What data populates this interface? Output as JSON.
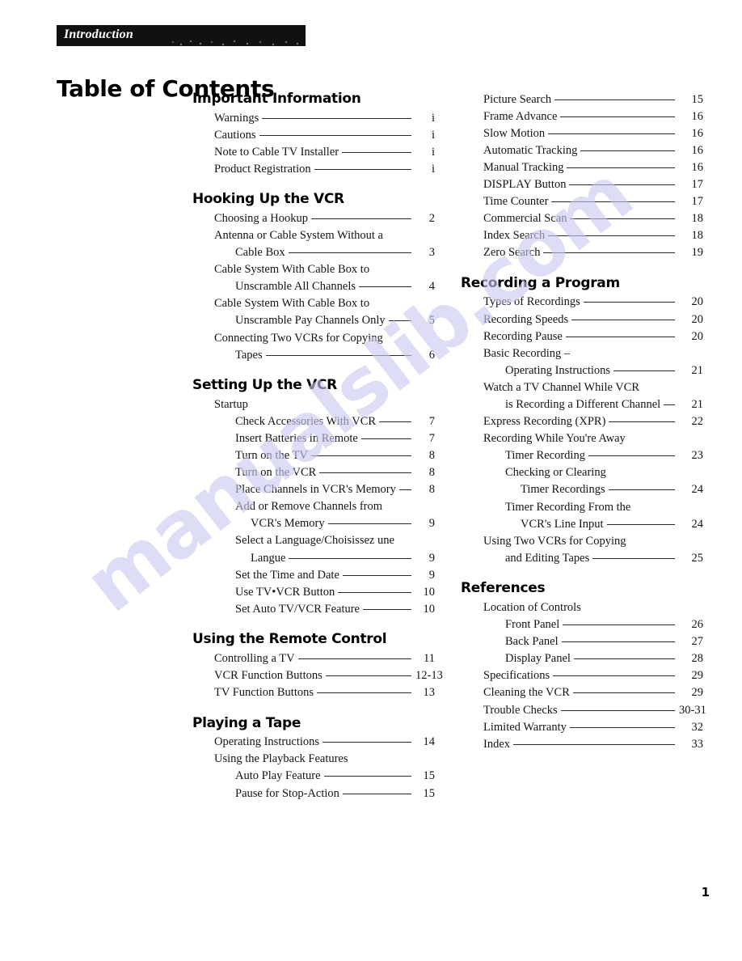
{
  "header": {
    "band_label": "Introduction",
    "page_title": "Table of Contents",
    "folio": "1"
  },
  "watermark": {
    "text": "manualslib.com"
  },
  "left_column": [
    {
      "heading": "Important Information",
      "entries": [
        {
          "title": "Warnings",
          "page": "i",
          "level": 1,
          "leader": true
        },
        {
          "title": "Cautions",
          "page": "i",
          "level": 1,
          "leader": true
        },
        {
          "title": "Note to Cable TV Installer",
          "page": "i",
          "level": 1,
          "leader": true
        },
        {
          "title": "Product Registration",
          "page": "i",
          "level": 1,
          "leader": true
        }
      ]
    },
    {
      "heading": "Hooking Up the VCR",
      "entries": [
        {
          "title": "Choosing a Hookup",
          "page": "2",
          "level": 1,
          "leader": true
        },
        {
          "title": "Antenna or Cable System Without a",
          "page": "",
          "level": 1,
          "leader": false
        },
        {
          "title": "Cable Box",
          "page": "3",
          "level": 2,
          "leader": true
        },
        {
          "title": "Cable System With Cable Box to",
          "page": "",
          "level": 1,
          "leader": false
        },
        {
          "title": "Unscramble All Channels",
          "page": "4",
          "level": 2,
          "leader": true
        },
        {
          "title": "Cable System With Cable Box to",
          "page": "",
          "level": 1,
          "leader": false
        },
        {
          "title": "Unscramble Pay Channels Only",
          "page": "5",
          "level": 2,
          "leader": true
        },
        {
          "title": "Connecting Two VCRs for Copying",
          "page": "",
          "level": 1,
          "leader": false
        },
        {
          "title": "Tapes",
          "page": "6",
          "level": 2,
          "leader": true
        }
      ]
    },
    {
      "heading": "Setting Up the VCR",
      "entries": [
        {
          "title": "Startup",
          "page": "",
          "level": 1,
          "leader": false
        },
        {
          "title": "Check Accessories With VCR",
          "page": "7",
          "level": 2,
          "leader": true
        },
        {
          "title": "Insert Batteries in Remote",
          "page": "7",
          "level": 2,
          "leader": true
        },
        {
          "title": "Turn on the TV",
          "page": "8",
          "level": 2,
          "leader": true
        },
        {
          "title": "Turn on the VCR",
          "page": "8",
          "level": 2,
          "leader": true
        },
        {
          "title": "Place Channels in VCR's Memory",
          "page": "8",
          "level": 2,
          "leader": true
        },
        {
          "title": "Add or Remove Channels from",
          "page": "",
          "level": 2,
          "leader": false
        },
        {
          "title": "VCR's Memory",
          "page": "9",
          "level": 3,
          "leader": true
        },
        {
          "title": "Select a Language/Choisissez une",
          "page": "",
          "level": 2,
          "leader": false
        },
        {
          "title": "Langue",
          "page": "9",
          "level": 3,
          "leader": true
        },
        {
          "title": "Set the Time and Date",
          "page": "9",
          "level": 2,
          "leader": true
        },
        {
          "title": "Use TV•VCR Button",
          "page": "10",
          "level": 2,
          "leader": true
        },
        {
          "title": "Set Auto TV/VCR Feature",
          "page": "10",
          "level": 2,
          "leader": true
        }
      ]
    },
    {
      "heading": "Using the Remote Control",
      "entries": [
        {
          "title": "Controlling a TV",
          "page": "11",
          "level": 1,
          "leader": true
        },
        {
          "title": "VCR Function Buttons",
          "page": "12-13",
          "level": 1,
          "leader": true
        },
        {
          "title": "TV Function Buttons",
          "page": "13",
          "level": 1,
          "leader": true
        }
      ]
    },
    {
      "heading": "Playing a Tape",
      "entries": [
        {
          "title": "Operating Instructions",
          "page": "14",
          "level": 1,
          "leader": true
        },
        {
          "title": "Using the Playback Features",
          "page": "",
          "level": 1,
          "leader": false
        },
        {
          "title": "Auto Play Feature",
          "page": "15",
          "level": 2,
          "leader": true
        },
        {
          "title": "Pause for Stop-Action",
          "page": "15",
          "level": 2,
          "leader": true
        }
      ]
    }
  ],
  "right_column": [
    {
      "heading": "",
      "entries": [
        {
          "title": "Picture Search",
          "page": "15",
          "level": 1,
          "leader": true
        },
        {
          "title": "Frame Advance",
          "page": "16",
          "level": 1,
          "leader": true
        },
        {
          "title": "Slow Motion",
          "page": "16",
          "level": 1,
          "leader": true
        },
        {
          "title": "Automatic Tracking",
          "page": "16",
          "level": 1,
          "leader": true
        },
        {
          "title": "Manual Tracking",
          "page": "16",
          "level": 1,
          "leader": true
        },
        {
          "title": "DISPLAY Button",
          "page": "17",
          "level": 1,
          "leader": true
        },
        {
          "title": "Time Counter",
          "page": "17",
          "level": 1,
          "leader": true
        },
        {
          "title": "Commercial Scan",
          "page": "18",
          "level": 1,
          "leader": true
        },
        {
          "title": "Index Search",
          "page": "18",
          "level": 1,
          "leader": true
        },
        {
          "title": "Zero Search",
          "page": "19",
          "level": 1,
          "leader": true
        }
      ]
    },
    {
      "heading": "Recording a Program",
      "entries": [
        {
          "title": "Types of Recordings",
          "page": "20",
          "level": 1,
          "leader": true
        },
        {
          "title": "Recording Speeds",
          "page": "20",
          "level": 1,
          "leader": true
        },
        {
          "title": "Recording Pause",
          "page": "20",
          "level": 1,
          "leader": true
        },
        {
          "title": "Basic Recording –",
          "page": "",
          "level": 1,
          "leader": false
        },
        {
          "title": "Operating Instructions",
          "page": "21",
          "level": 2,
          "leader": true
        },
        {
          "title": "Watch a TV Channel While VCR",
          "page": "",
          "level": 1,
          "leader": false
        },
        {
          "title": "is Recording a Different Channel",
          "page": "21",
          "level": 2,
          "leader": true
        },
        {
          "title": "Express Recording (XPR)",
          "page": "22",
          "level": 1,
          "leader": true
        },
        {
          "title": "Recording While You're Away",
          "page": "",
          "level": 1,
          "leader": false
        },
        {
          "title": "Timer Recording",
          "page": "23",
          "level": 2,
          "leader": true
        },
        {
          "title": "Checking or Clearing",
          "page": "",
          "level": 2,
          "leader": false
        },
        {
          "title": "Timer Recordings",
          "page": "24",
          "level": 3,
          "leader": true
        },
        {
          "title": "Timer Recording From the",
          "page": "",
          "level": 2,
          "leader": false
        },
        {
          "title": "VCR's Line Input",
          "page": "24",
          "level": 3,
          "leader": true
        },
        {
          "title": "Using Two VCRs for Copying",
          "page": "",
          "level": 1,
          "leader": false
        },
        {
          "title": "and Editing Tapes",
          "page": "25",
          "level": 2,
          "leader": true
        }
      ]
    },
    {
      "heading": "References",
      "entries": [
        {
          "title": "Location of Controls",
          "page": "",
          "level": 1,
          "leader": false
        },
        {
          "title": "Front Panel",
          "page": "26",
          "level": 2,
          "leader": true
        },
        {
          "title": "Back Panel",
          "page": "27",
          "level": 2,
          "leader": true
        },
        {
          "title": "Display Panel",
          "page": "28",
          "level": 2,
          "leader": true
        },
        {
          "title": "Specifications",
          "page": "29",
          "level": 1,
          "leader": true
        },
        {
          "title": "Cleaning the VCR",
          "page": "29",
          "level": 1,
          "leader": true
        },
        {
          "title": "Trouble Checks",
          "page": "30-31",
          "level": 1,
          "leader": true
        },
        {
          "title": "Limited Warranty",
          "page": "32",
          "level": 1,
          "leader": true
        },
        {
          "title": "Index",
          "page": "33",
          "level": 1,
          "leader": true
        }
      ]
    }
  ]
}
